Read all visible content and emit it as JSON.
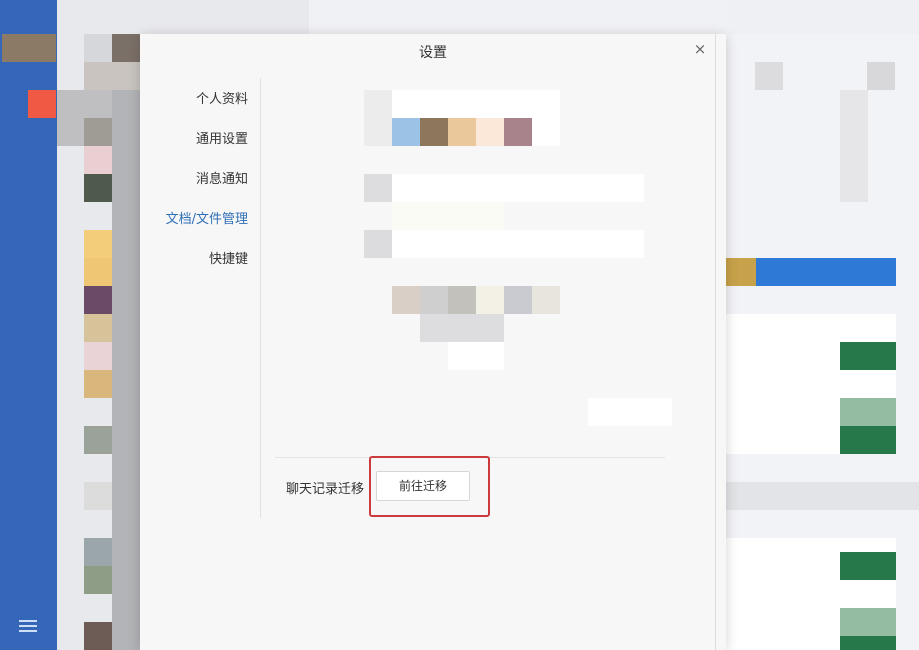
{
  "dialog": {
    "title": "设置",
    "close_symbol": "×"
  },
  "nav": {
    "items": [
      {
        "label": "个人资料",
        "active": false
      },
      {
        "label": "通用设置",
        "active": false
      },
      {
        "label": "消息通知",
        "active": false
      },
      {
        "label": "文档/文件管理",
        "active": true
      },
      {
        "label": "快捷键",
        "active": false
      }
    ]
  },
  "content": {
    "chat_migration": {
      "label": "聊天记录迁移",
      "button_label": "前往迁移"
    }
  },
  "colors": {
    "rail": "#3467b8",
    "active_nav": "#2f6fb5",
    "highlight_box": "#cc3b3b"
  },
  "icons": {
    "rail_menu": "hamburger-icon",
    "close": "close-icon"
  }
}
